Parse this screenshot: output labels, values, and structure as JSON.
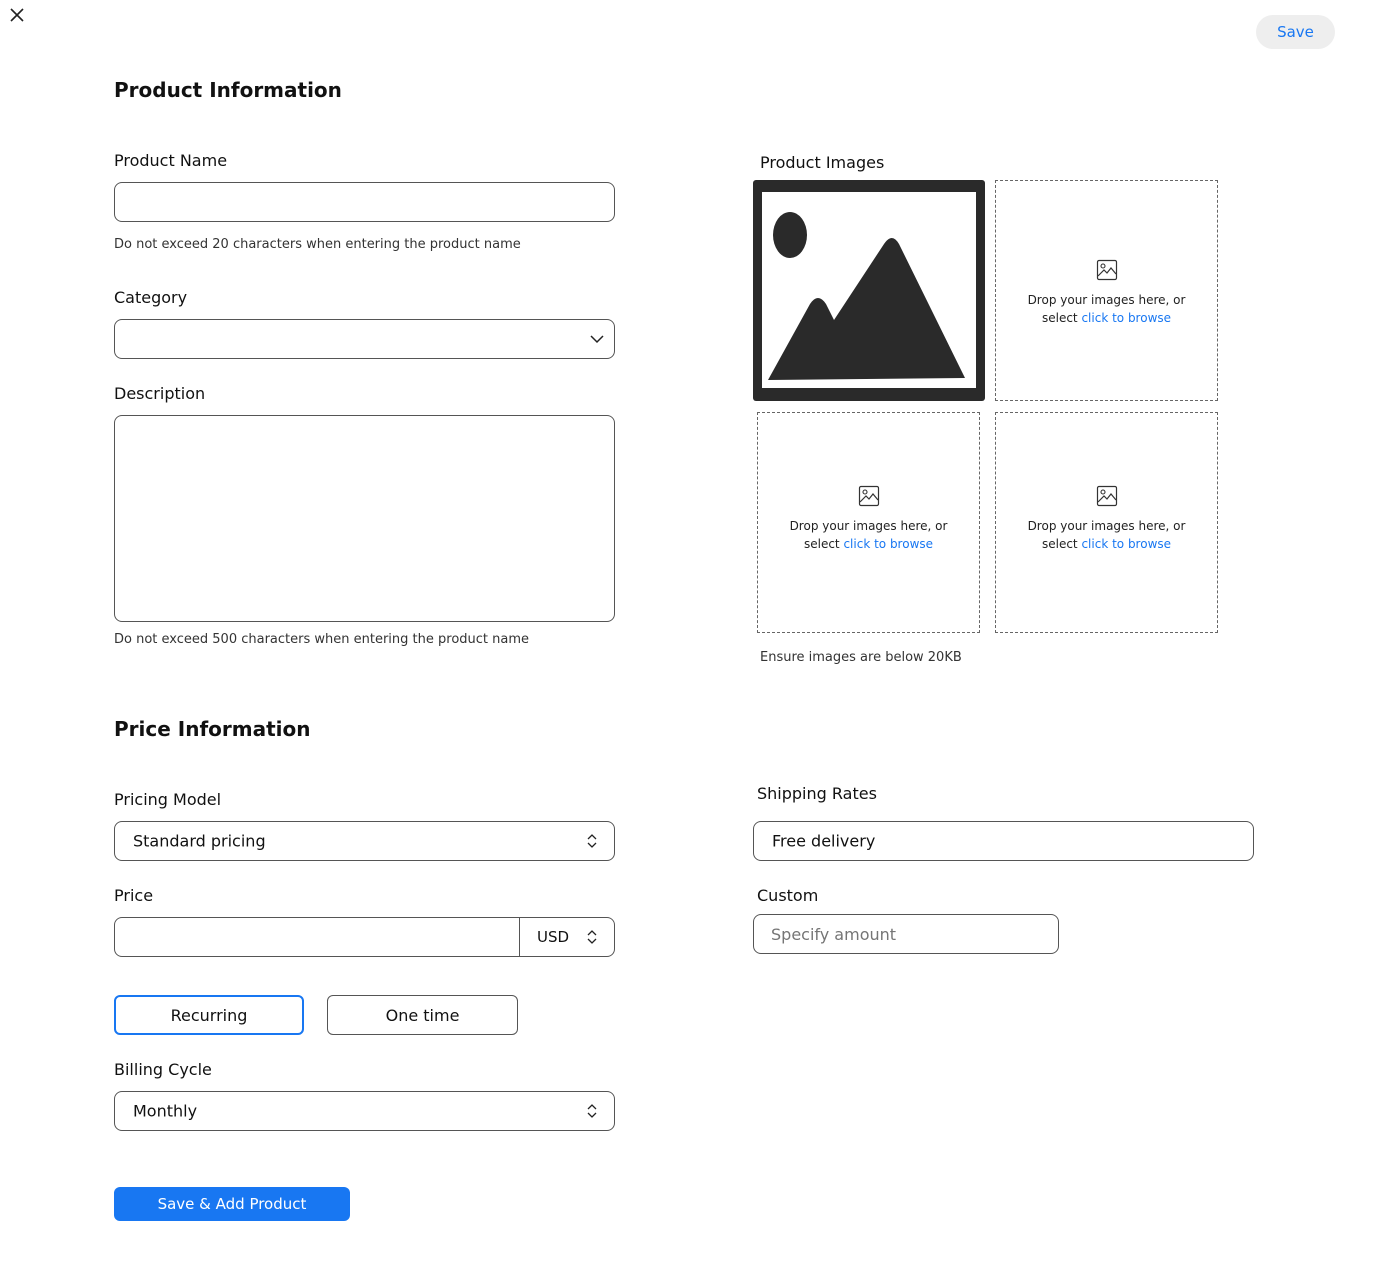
{
  "header": {
    "save_label": "Save"
  },
  "product_info": {
    "title": "Product Information",
    "name": {
      "label": "Product Name",
      "value": "",
      "hint": "Do not exceed 20 characters when entering the product name"
    },
    "category": {
      "label": "Category",
      "value": ""
    },
    "description": {
      "label": "Description",
      "value": "",
      "hint": "Do not exceed 500 characters when entering the product name"
    }
  },
  "images": {
    "label": "Product Images",
    "drop_text": "Drop your images here, or",
    "select_text": "select",
    "browse_link": "click to browse",
    "hint": "Ensure images are below 20KB"
  },
  "price_info": {
    "title": "Price Information",
    "pricing_model": {
      "label": "Pricing Model",
      "value": "Standard pricing"
    },
    "price": {
      "label": "Price",
      "value": "",
      "currency": "USD"
    },
    "toggle": {
      "recurring": "Recurring",
      "one_time": "One time",
      "selected": "Recurring"
    },
    "billing_cycle": {
      "label": "Billing Cycle",
      "value": "Monthly"
    },
    "shipping": {
      "label": "Shipping Rates",
      "value": "Free delivery"
    },
    "custom": {
      "label": "Custom",
      "placeholder": "Specify amount"
    }
  },
  "footer": {
    "submit_label": "Save & Add Product"
  },
  "colors": {
    "accent": "#1877f2",
    "border": "#555555",
    "focus_border": "#1877f2"
  }
}
